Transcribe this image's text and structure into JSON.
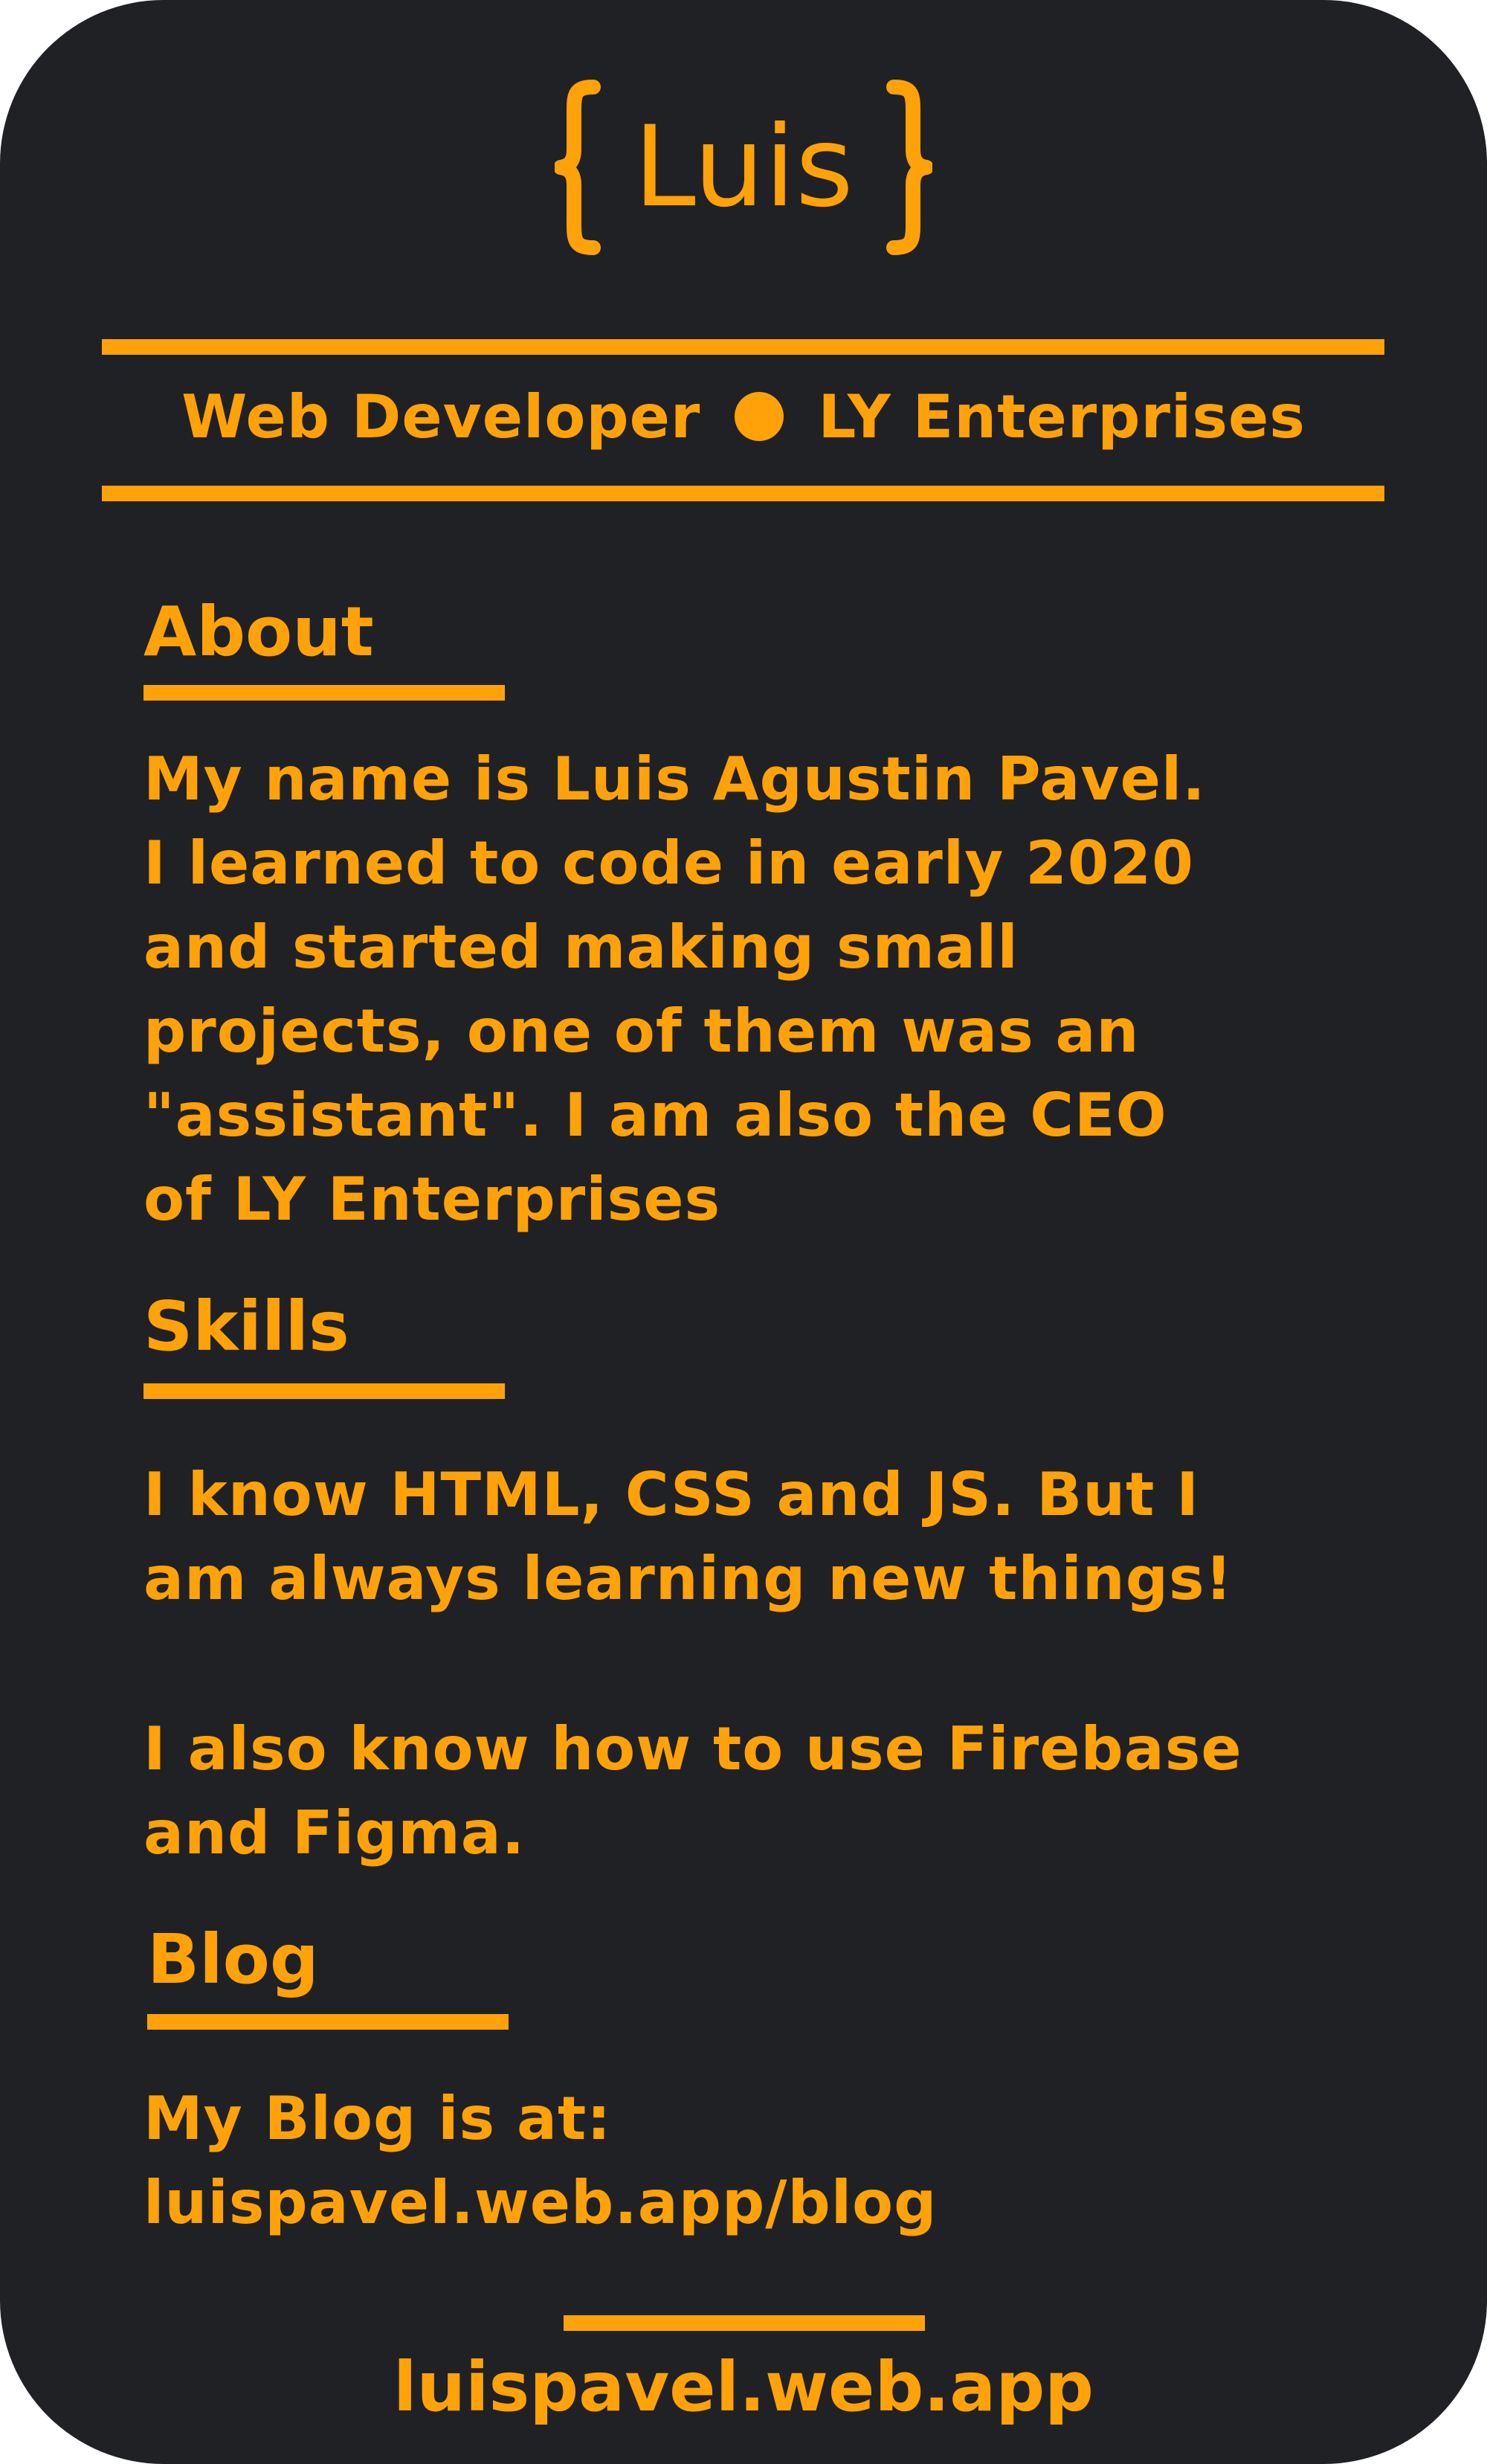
{
  "colors": {
    "background": "#202124",
    "accent": "#FFA20A"
  },
  "header": {
    "name": "Luis",
    "open_brace": "{",
    "close_brace": "}",
    "role": "Web Developer",
    "company": "LY Enterprises"
  },
  "sections": {
    "about": {
      "title": "About",
      "text": "My name is Luis Agustin Pavel.\nI learned to code in early 2020\nand started making small\nprojects, one of them was an\n\"assistant\". I am also the CEO\nof LY Enterprises"
    },
    "skills": {
      "title": "Skills",
      "text": "I know HTML, CSS and JS. But I\nam always learning new things!",
      "text2": "I also know how to use Firebase\nand Figma."
    },
    "blog": {
      "title": "Blog",
      "text": "My Blog is at:\nluispavel.web.app/blog"
    }
  },
  "footer": {
    "link": "luispavel.web.app"
  }
}
